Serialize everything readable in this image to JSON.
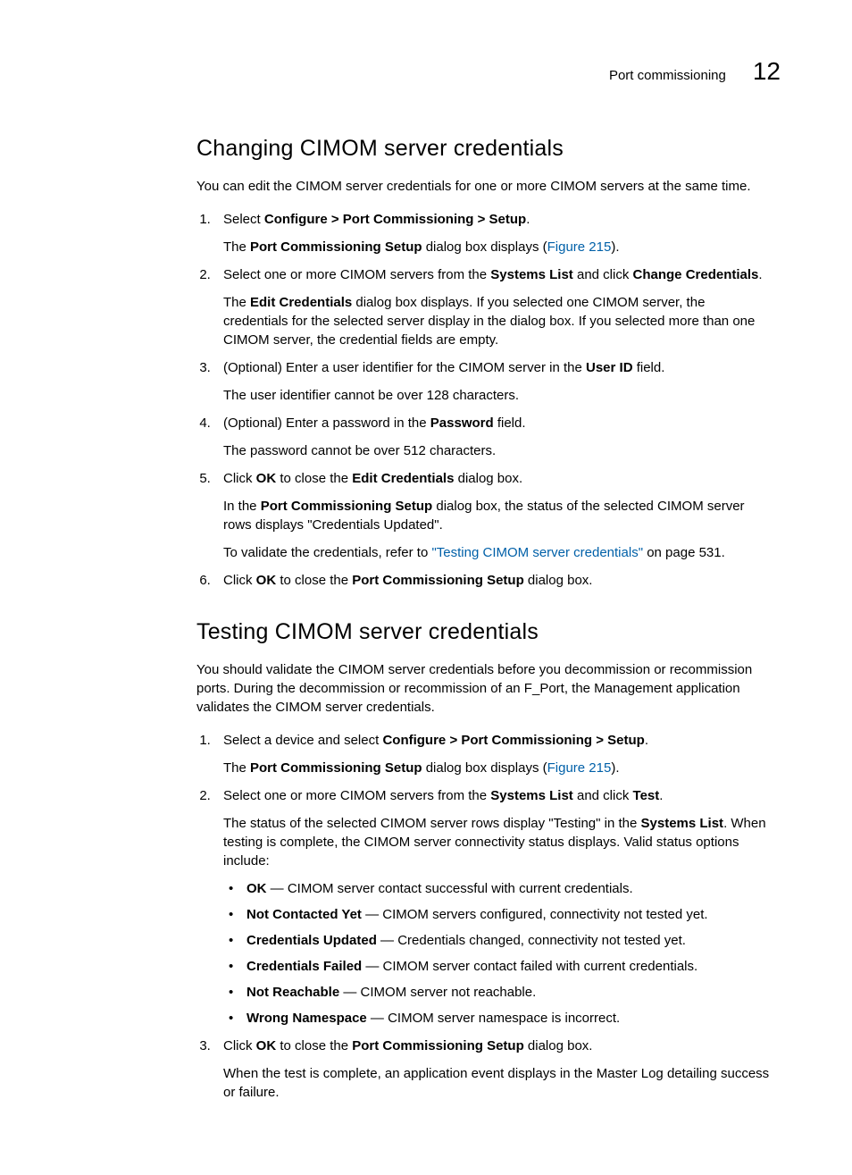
{
  "header": {
    "section": "Port commissioning",
    "chapter": "12"
  },
  "s1": {
    "title": "Changing CIMOM server credentials",
    "intro": "You can edit the CIMOM server credentials for one or more CIMOM servers at the same time.",
    "step1": {
      "a": "Select ",
      "b": "Configure > Port Commissioning > Setup",
      "c": ".",
      "p2a": "The ",
      "p2b": "Port Commissioning Setup",
      "p2c": " dialog box displays (",
      "p2link": "Figure 215",
      "p2d": ")."
    },
    "step2": {
      "a": "Select one or more CIMOM servers from the ",
      "b": "Systems List",
      "c": " and click ",
      "d": "Change Credentials",
      "e": ".",
      "p2a": "The ",
      "p2b": "Edit Credentials",
      "p2c": " dialog box displays. If you selected one CIMOM server, the credentials for the selected server display in the dialog box. If you selected more than one CIMOM server, the credential fields are empty."
    },
    "step3": {
      "a": "(Optional) Enter a user identifier for the CIMOM server in the ",
      "b": "User ID",
      "c": " field.",
      "p2": "The user identifier cannot be over 128 characters."
    },
    "step4": {
      "a": "(Optional) Enter a password in the ",
      "b": "Password",
      "c": " field.",
      "p2": "The password cannot be over 512 characters."
    },
    "step5": {
      "a": "Click ",
      "b": "OK",
      "c": " to close the ",
      "d": "Edit Credentials",
      "e": " dialog box.",
      "p2a": "In the ",
      "p2b": "Port Commissioning Setup",
      "p2c": " dialog box, the status of the selected CIMOM server rows displays \"Credentials Updated\".",
      "p3a": "To validate the credentials, refer to ",
      "p3link": "\"Testing CIMOM server credentials\"",
      "p3b": " on page 531."
    },
    "step6": {
      "a": "Click ",
      "b": "OK",
      "c": " to close the ",
      "d": "Port Commissioning Setup",
      "e": " dialog box."
    }
  },
  "s2": {
    "title": "Testing CIMOM server credentials",
    "intro": "You should validate the CIMOM server credentials before you decommission or recommission ports. During the decommission or recommission of an F_Port, the Management application validates the CIMOM server credentials.",
    "step1": {
      "a": "Select a device and select ",
      "b": "Configure > Port Commissioning > Setup",
      "c": ".",
      "p2a": "The ",
      "p2b": "Port Commissioning Setup",
      "p2c": " dialog box displays (",
      "p2link": "Figure 215",
      "p2d": ")."
    },
    "step2": {
      "a": "Select one or more CIMOM servers from the ",
      "b": "Systems List",
      "c": " and click ",
      "d": "Test",
      "e": ".",
      "p2a": "The status of the selected CIMOM server rows display \"Testing\" in the ",
      "p2b": "Systems List",
      "p2c": ". When testing is complete, the CIMOM server connectivity status displays. Valid status options include:",
      "bullets": {
        "ok_b": "OK",
        "ok_t": " — CIMOM server contact successful with current credentials.",
        "ncy_b": "Not Contacted Yet",
        "ncy_t": " — CIMOM servers configured, connectivity not tested yet.",
        "cu_b": "Credentials Updated",
        "cu_t": " — Credentials changed, connectivity not tested yet.",
        "cf_b": "Credentials Failed",
        "cf_t": " — CIMOM server contact failed with current credentials.",
        "nr_b": "Not Reachable",
        "nr_t": " — CIMOM server not reachable.",
        "wn_b": "Wrong Namespace",
        "wn_t": " —  CIMOM server namespace is incorrect."
      }
    },
    "step3": {
      "a": "Click ",
      "b": "OK",
      "c": " to close the ",
      "d": "Port Commissioning Setup",
      "e": " dialog box.",
      "p2": "When the test is complete, an application event displays in the Master Log detailing success or failure."
    }
  }
}
